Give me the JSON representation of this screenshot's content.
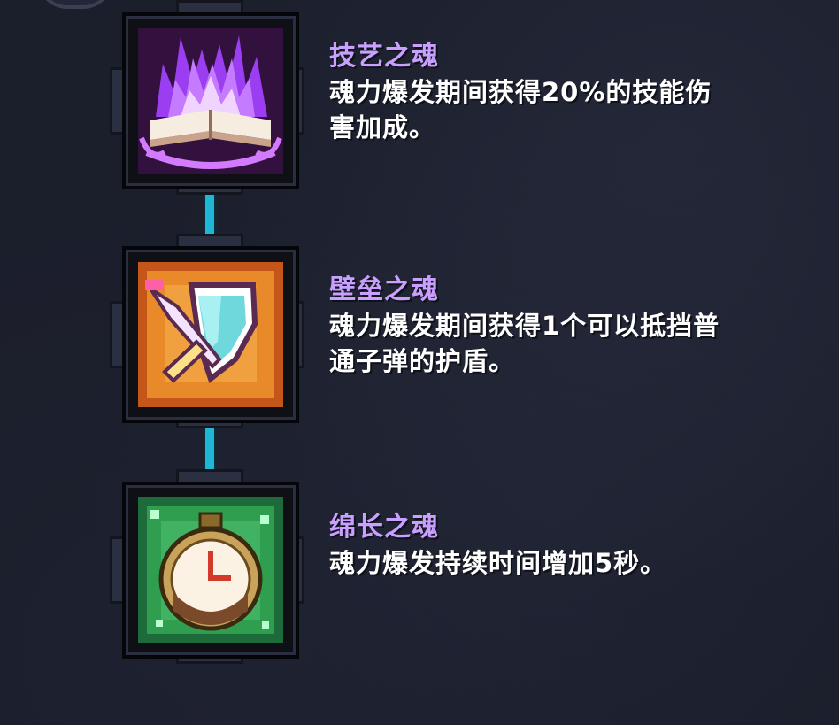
{
  "skills": [
    {
      "name": "技艺之魂",
      "description": "魂力爆发期间获得20%的技能伤\n害加成。",
      "icon": "purple-flame-book-icon",
      "theme_color": "#8a2bd8"
    },
    {
      "name": "壁垒之魂",
      "description": "魂力爆发期间获得1个可以抵挡普\n通子弹的护盾。",
      "icon": "shield-sword-icon",
      "theme_color": "#e07a1a"
    },
    {
      "name": "绵长之魂",
      "description": "魂力爆发持续时间增加5秒。",
      "icon": "stopwatch-icon",
      "theme_color": "#2f9e4e"
    }
  ],
  "colors": {
    "name_text": "#c9a0ff",
    "desc_text": "#ffffff",
    "connector": "#1fb7d6",
    "background": "#1b1e2b"
  }
}
